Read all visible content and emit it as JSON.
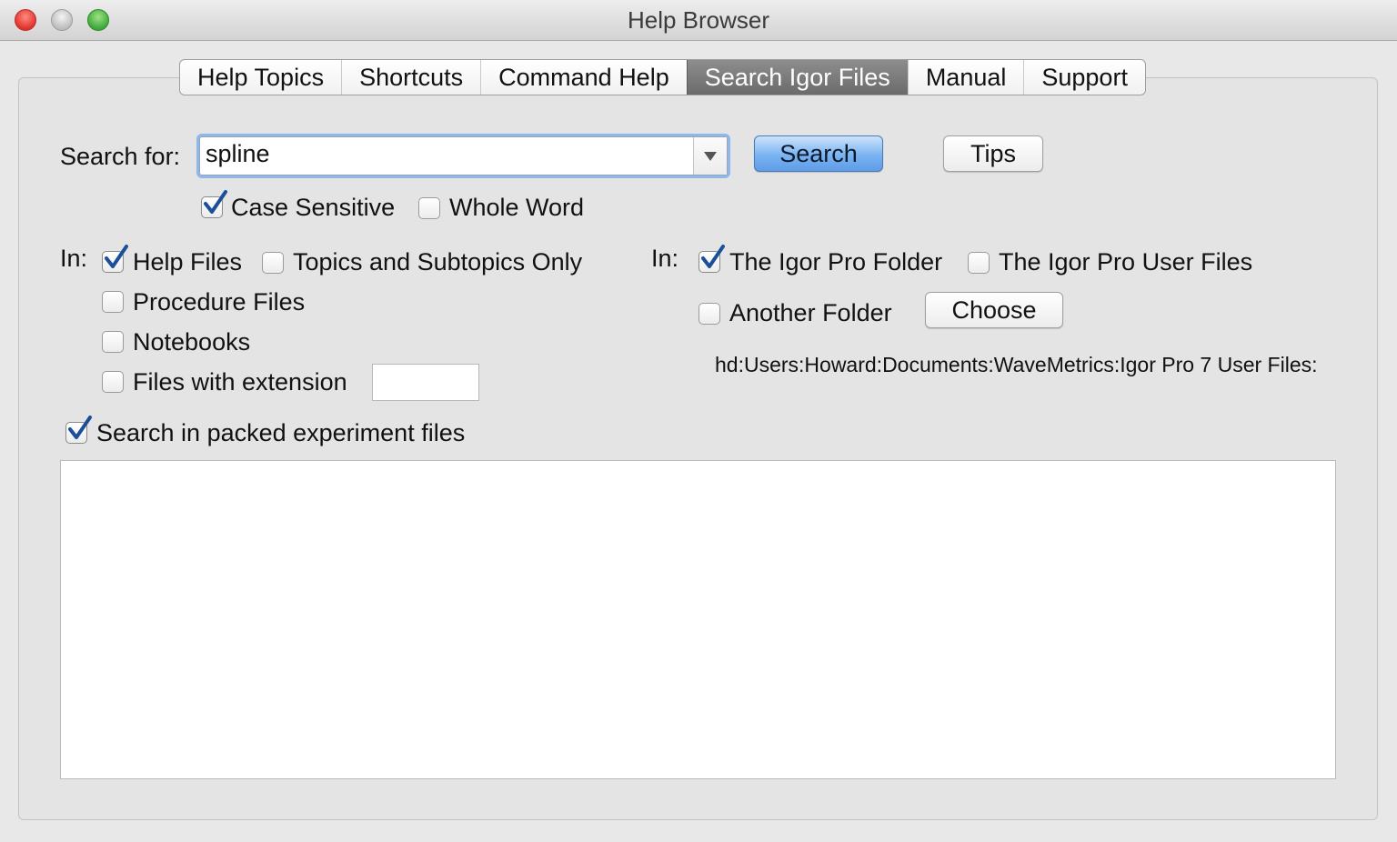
{
  "window": {
    "title": "Help Browser"
  },
  "tabs": [
    {
      "label": "Help Topics",
      "active": false
    },
    {
      "label": "Shortcuts",
      "active": false
    },
    {
      "label": "Command Help",
      "active": false
    },
    {
      "label": "Search Igor Files",
      "active": true
    },
    {
      "label": "Manual",
      "active": false
    },
    {
      "label": "Support",
      "active": false
    }
  ],
  "search": {
    "label": "Search for:",
    "value": "spline",
    "search_button": "Search",
    "tips_button": "Tips"
  },
  "options": {
    "case_sensitive": {
      "label": "Case Sensitive",
      "checked": true
    },
    "whole_word": {
      "label": "Whole Word",
      "checked": false
    }
  },
  "in_files": {
    "label": "In:",
    "help_files": {
      "label": "Help Files",
      "checked": true
    },
    "topics_only": {
      "label": "Topics and Subtopics Only",
      "checked": false
    },
    "procedure_files": {
      "label": "Procedure Files",
      "checked": false
    },
    "notebooks": {
      "label": "Notebooks",
      "checked": false
    },
    "files_with_extension": {
      "label": "Files with extension",
      "checked": false,
      "value": ""
    }
  },
  "in_folders": {
    "label": "In:",
    "igor_pro_folder": {
      "label": "The Igor Pro Folder",
      "checked": true
    },
    "igor_pro_user_files": {
      "label": "The Igor Pro User Files",
      "checked": false
    },
    "another_folder": {
      "label": "Another Folder",
      "checked": false
    },
    "choose_button": "Choose",
    "path": "hd:Users:Howard:Documents:WaveMetrics:Igor Pro 7 User Files:"
  },
  "packed_experiments": {
    "label": "Search in packed experiment files",
    "checked": true
  },
  "colors": {
    "active_tab": "#7a7a7a",
    "default_button": "#79b3f2",
    "check_mark": "#1b4f9a"
  }
}
